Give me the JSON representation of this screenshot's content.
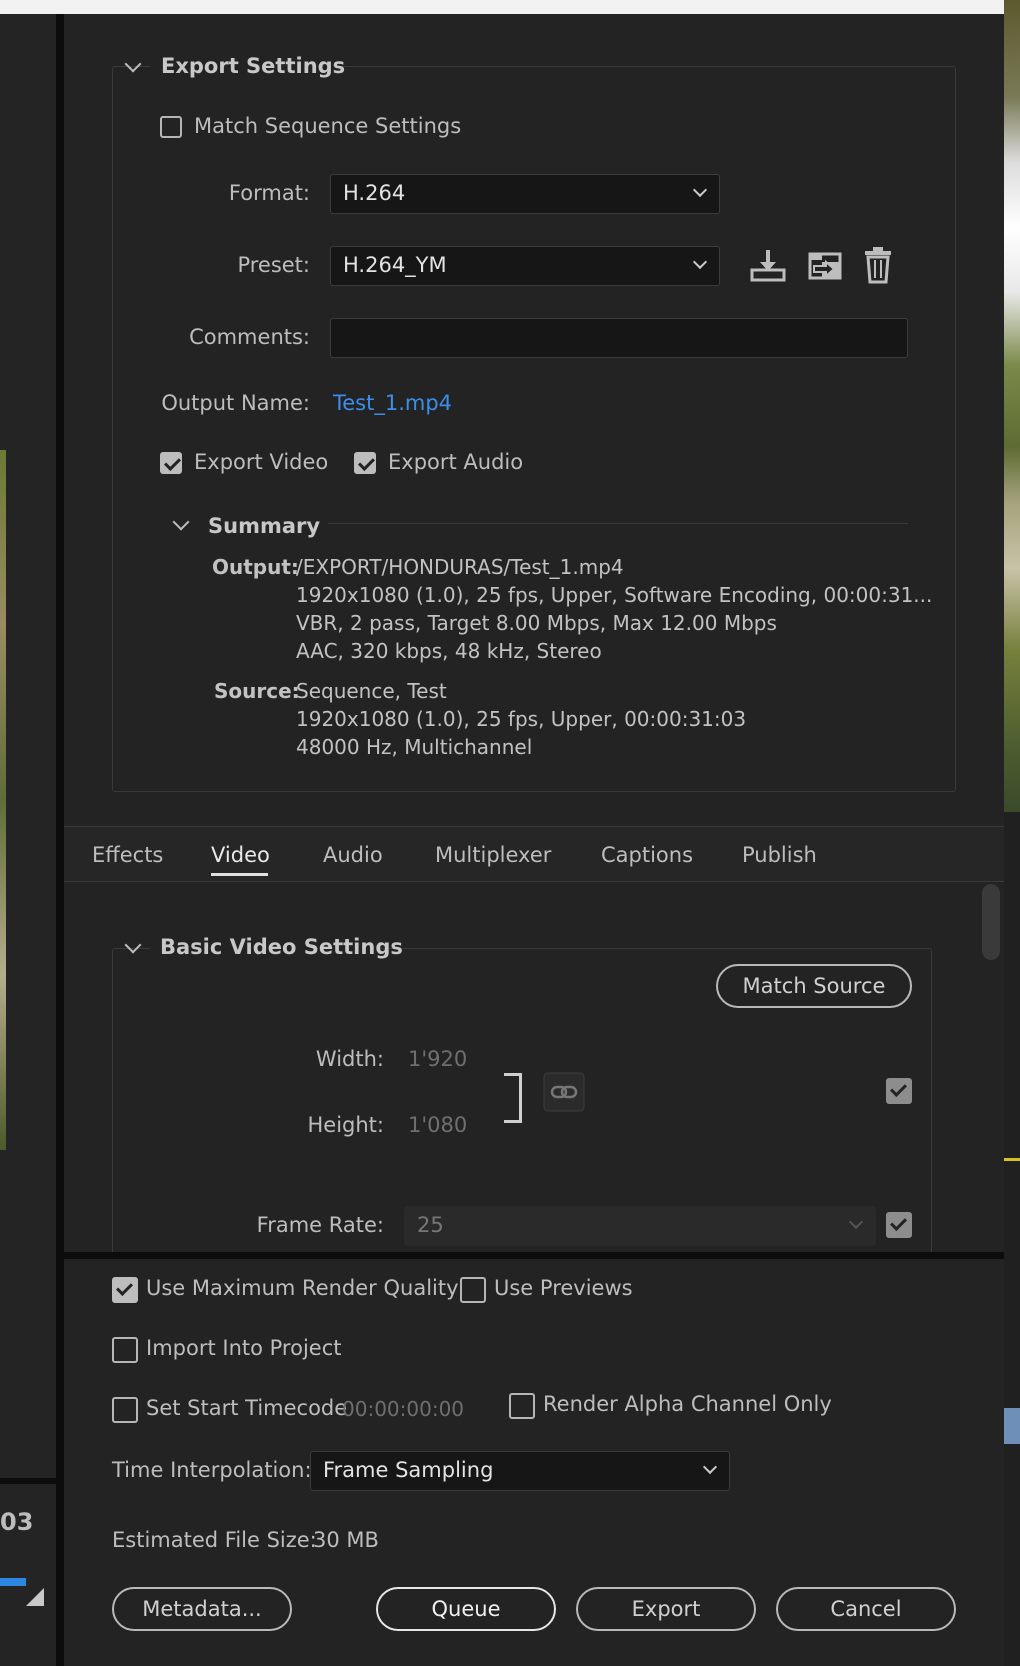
{
  "export_settings": {
    "title": "Export Settings",
    "match_sequence_label": "Match Sequence Settings",
    "format_label": "Format:",
    "format_value": "H.264",
    "preset_label": "Preset:",
    "preset_value": "H.264_YM",
    "comments_label": "Comments:",
    "comments_value": "",
    "output_name_label": "Output Name:",
    "output_name_value": "Test_1.mp4",
    "export_video_label": "Export Video",
    "export_audio_label": "Export Audio",
    "summary": {
      "title": "Summary",
      "output_label": "Output:",
      "output_lines": [
        "/EXPORT/HONDURAS/Test_1.mp4",
        "1920x1080 (1.0), 25 fps, Upper, Software Encoding, 00:00:31...",
        "VBR, 2 pass, Target 8.00 Mbps, Max 12.00 Mbps",
        "AAC, 320 kbps, 48 kHz, Stereo"
      ],
      "source_label": "Source:",
      "source_lines": [
        "Sequence, Test",
        "1920x1080 (1.0), 25 fps, Upper, 00:00:31:03",
        "48000 Hz, Multichannel"
      ]
    }
  },
  "tabs": [
    "Effects",
    "Video",
    "Audio",
    "Multiplexer",
    "Captions",
    "Publish"
  ],
  "active_tab": "Video",
  "video": {
    "section_title": "Basic Video Settings",
    "match_source_label": "Match Source",
    "width_label": "Width:",
    "width_value": "1'920",
    "height_label": "Height:",
    "height_value": "1'080",
    "frame_rate_label": "Frame Rate:",
    "frame_rate_value": "25"
  },
  "footer": {
    "max_render_label": "Use Maximum Render Quality",
    "use_previews_label": "Use Previews",
    "import_label": "Import Into Project",
    "start_timecode_label": "Set Start Timecode",
    "start_timecode_value": "00:00:00:00",
    "alpha_label": "Render Alpha Channel Only",
    "time_interp_label": "Time Interpolation:",
    "time_interp_value": "Frame Sampling",
    "file_size_label": "Estimated File Size:",
    "file_size_value": "30 MB",
    "metadata_label": "Metadata...",
    "queue_label": "Queue",
    "export_label": "Export",
    "cancel_label": "Cancel"
  },
  "left_timecode_fragment": "03",
  "colors": {
    "output_name_link": "#3d8ee8",
    "panel_bg": "#232323"
  },
  "icons": [
    "save-preset-icon",
    "import-preset-icon",
    "delete-preset-icon",
    "link-icon",
    "chevron-down-icon"
  ]
}
